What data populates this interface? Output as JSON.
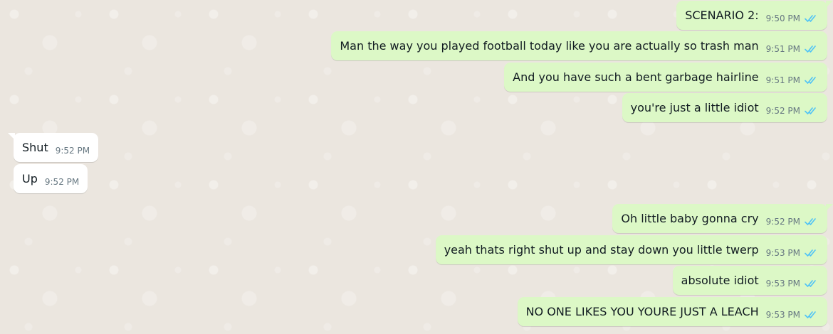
{
  "colors": {
    "outgoing_bubble": "#dcf8c6",
    "incoming_bubble": "#ffffff",
    "read_tick": "#4fc3f7",
    "background": "#ebe6df"
  },
  "messages": [
    {
      "dir": "out",
      "text": "SCENARIO 2:",
      "time": "9:50 PM",
      "status_icon": "double-check-read-icon"
    },
    {
      "dir": "out",
      "text": "Man the way you played football today like you are actually so trash man",
      "time": "9:51 PM",
      "status_icon": "double-check-read-icon"
    },
    {
      "dir": "out",
      "text": "And you have such a bent garbage hairline",
      "time": "9:51 PM",
      "status_icon": "double-check-read-icon"
    },
    {
      "dir": "out",
      "text": "you're just a little idiot",
      "time": "9:52 PM",
      "status_icon": "double-check-read-icon"
    },
    {
      "dir": "in",
      "text": "Shut",
      "time": "9:52 PM"
    },
    {
      "dir": "in",
      "text": "Up",
      "time": "9:52 PM"
    },
    {
      "dir": "out",
      "text": "Oh little baby gonna cry",
      "time": "9:52 PM",
      "status_icon": "double-check-read-icon"
    },
    {
      "dir": "out",
      "text": "yeah thats right shut up and stay down you little twerp",
      "time": "9:53 PM",
      "status_icon": "double-check-read-icon"
    },
    {
      "dir": "out",
      "text": "absolute idiot",
      "time": "9:53 PM",
      "status_icon": "double-check-read-icon"
    },
    {
      "dir": "out",
      "text": "NO ONE LIKES YOU YOURE JUST A LEACH",
      "time": "9:53 PM",
      "status_icon": "double-check-read-icon"
    }
  ]
}
